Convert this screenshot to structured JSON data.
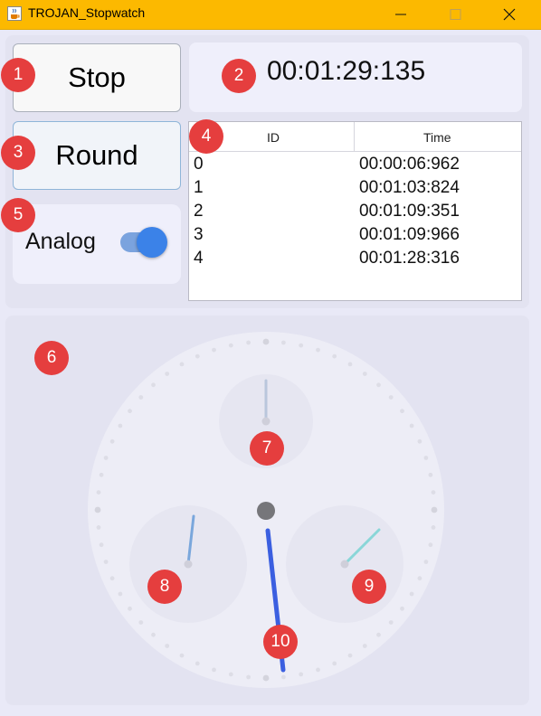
{
  "window": {
    "title": "TROJAN_Stopwatch",
    "icon": "java-cup-icon",
    "titlebar_color": "#fcb900"
  },
  "controls": {
    "stop_label": "Stop",
    "round_label": "Round",
    "analog_label": "Analog",
    "analog_enabled": true
  },
  "display": {
    "elapsed": "00:01:29:135"
  },
  "rounds": {
    "headers": [
      "ID",
      "Time"
    ],
    "rows": [
      {
        "id": "0",
        "time": "00:00:06:962"
      },
      {
        "id": "1",
        "time": "00:01:03:824"
      },
      {
        "id": "2",
        "time": "00:01:09:351"
      },
      {
        "id": "3",
        "time": "00:01:09:966"
      },
      {
        "id": "4",
        "time": "00:01:28:316"
      }
    ]
  },
  "markers": [
    "1",
    "2",
    "3",
    "4",
    "5",
    "6",
    "7",
    "8",
    "9",
    "10"
  ],
  "colors": {
    "marker": "#e53e3e",
    "toggle_on": "#3b82e8",
    "main_hand": "#3b5fe0",
    "left_subdial_hand": "#7aa7dc",
    "right_subdial_hand": "#8ad6d8",
    "top_subdial_hand": "#b9c6dc",
    "center_pin": "#76767a"
  }
}
